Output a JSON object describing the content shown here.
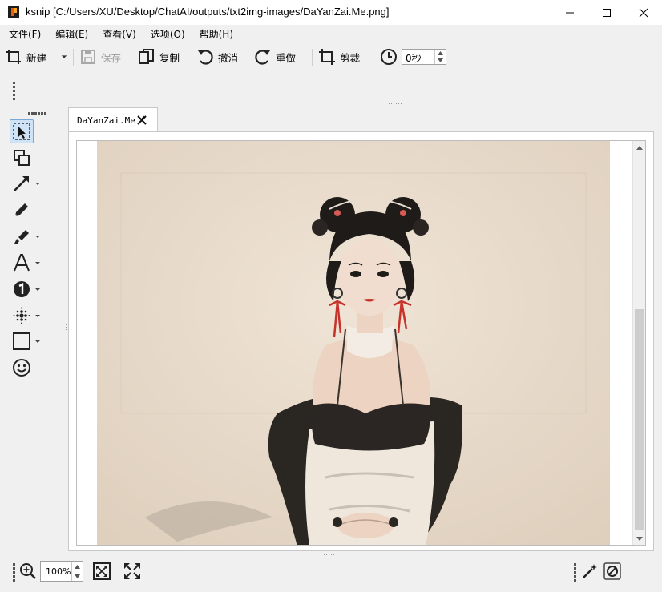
{
  "window": {
    "title": "ksnip [C:/Users/XU/Desktop/ChatAI/outputs/txt2img-images/DaYanZai.Me.png]",
    "app_icon": "ksnip-icon",
    "controls": [
      "minimize-icon",
      "maximize-icon",
      "close-icon"
    ]
  },
  "menu": [
    {
      "label": "文件(F)"
    },
    {
      "label": "编辑(E)"
    },
    {
      "label": "查看(V)"
    },
    {
      "label": "选项(O)"
    },
    {
      "label": "帮助(H)"
    }
  ],
  "toolbar": {
    "new": "新建",
    "save": "保存",
    "copy": "复制",
    "undo": "撤消",
    "redo": "重做",
    "crop": "剪裁",
    "delay_value": "0秒"
  },
  "tools": [
    {
      "name": "select-tool",
      "icon": "select-icon",
      "active": true,
      "dropdown": false
    },
    {
      "name": "duplicate-tool",
      "icon": "duplicate-icon",
      "active": false,
      "dropdown": false
    },
    {
      "name": "arrow-tool",
      "icon": "arrow-icon",
      "active": false,
      "dropdown": true
    },
    {
      "name": "pen-tool",
      "icon": "pen-icon",
      "active": false,
      "dropdown": false
    },
    {
      "name": "marker-tool",
      "icon": "marker-icon",
      "active": false,
      "dropdown": true
    },
    {
      "name": "text-tool",
      "icon": "text-icon",
      "active": false,
      "dropdown": true
    },
    {
      "name": "number-tool",
      "icon": "number-icon",
      "active": false,
      "dropdown": true
    },
    {
      "name": "blur-tool",
      "icon": "blur-icon",
      "active": false,
      "dropdown": true
    },
    {
      "name": "rectangle-tool",
      "icon": "rectangle-icon",
      "active": false,
      "dropdown": true
    },
    {
      "name": "sticker-tool",
      "icon": "smiley-icon",
      "active": false,
      "dropdown": false
    }
  ],
  "tab": {
    "label": "DaYanZai.Me"
  },
  "status": {
    "zoom": "100%"
  },
  "colors": {
    "accent": "#cfe3f7",
    "ribbon": "#c7322b"
  }
}
